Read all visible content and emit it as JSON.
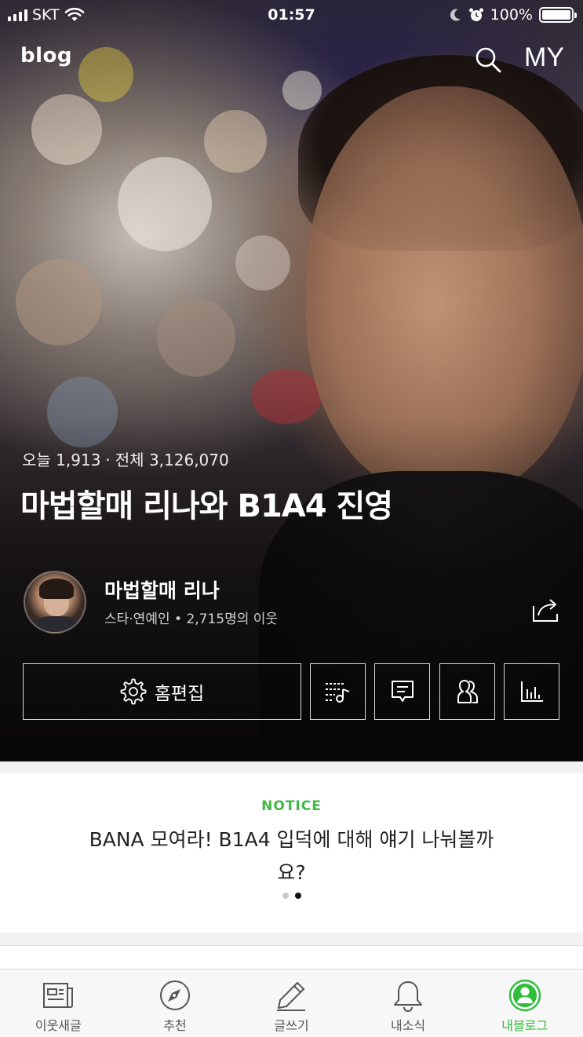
{
  "status_bar": {
    "carrier": "SKT",
    "time": "01:57",
    "battery": "100%"
  },
  "header": {
    "logo": "blog",
    "my_label": "MY"
  },
  "blog": {
    "today_label": "오늘 1,913",
    "separator": "·",
    "total_label": "전체 3,126,070",
    "title": "마법할매 리나와 B1A4 진영",
    "owner_name": "마법할매 리나",
    "owner_meta": "스타·연예인 • 2,715명의 이웃"
  },
  "actions": {
    "edit_label": "홈편집"
  },
  "notice": {
    "label": "NOTICE",
    "text": "BANA 모여라! B1A4 입덕에 대해 얘기 나눠볼까요?",
    "page_count": 2,
    "active_page": 2
  },
  "tabbar": {
    "tabs": [
      {
        "label": "이웃새글",
        "icon": "newspaper-icon"
      },
      {
        "label": "추천",
        "icon": "compass-icon"
      },
      {
        "label": "글쓰기",
        "icon": "pencil-icon"
      },
      {
        "label": "내소식",
        "icon": "bell-icon"
      },
      {
        "label": "내블로그",
        "icon": "profile-icon"
      }
    ],
    "active_index": 4
  },
  "colors": {
    "accent_green": "#2fbd3a",
    "notice_green": "#3fb944"
  }
}
